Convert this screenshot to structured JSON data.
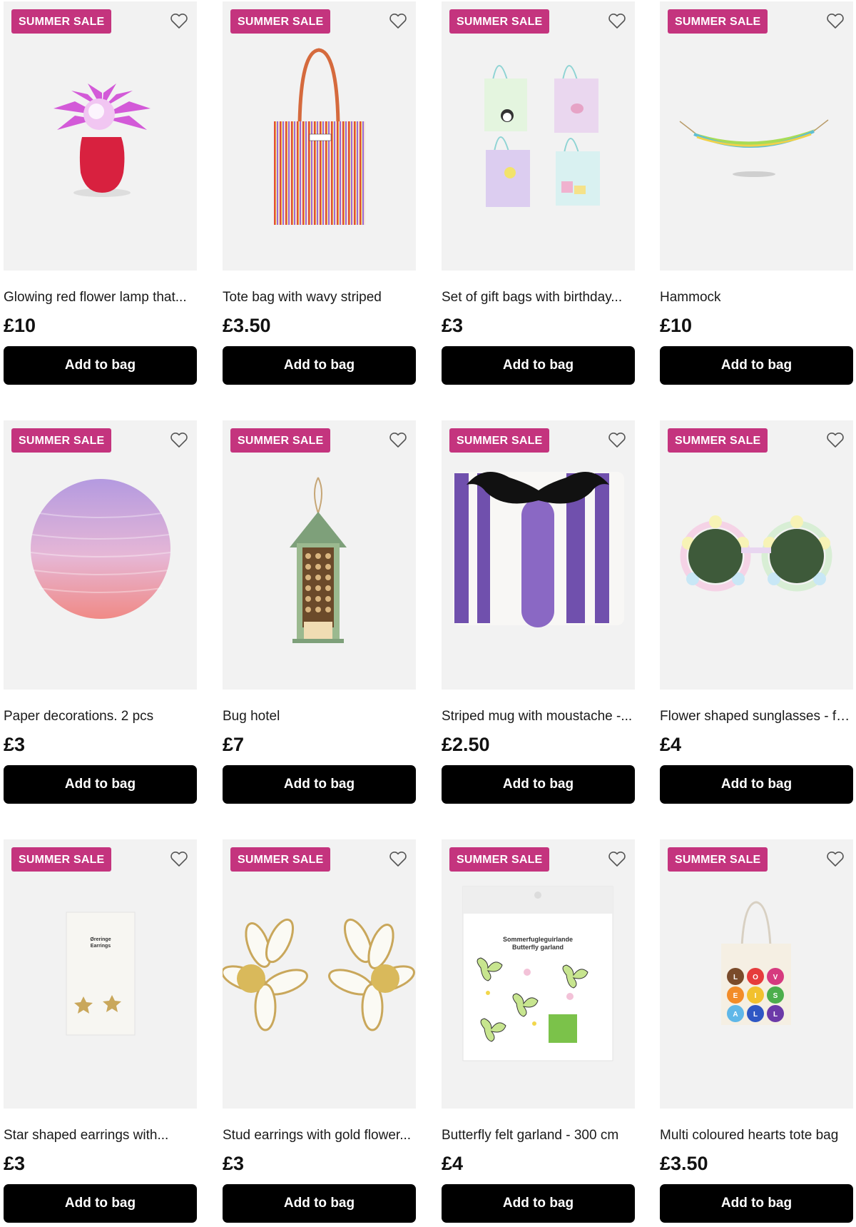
{
  "badge_label": "SUMMER SALE",
  "add_label": "Add to bag",
  "products": [
    {
      "title": "Glowing red flower lamp that...",
      "price": "£10",
      "image": "flower-lamp"
    },
    {
      "title": "Tote bag with wavy striped",
      "price": "£3.50",
      "image": "striped-tote"
    },
    {
      "title": "Set of gift bags with birthday...",
      "price": "£3",
      "image": "gift-bags"
    },
    {
      "title": "Hammock",
      "price": "£10",
      "image": "hammock"
    },
    {
      "title": "Paper decorations. 2 pcs",
      "price": "£3",
      "image": "paper-lantern"
    },
    {
      "title": "Bug hotel",
      "price": "£7",
      "image": "bug-hotel"
    },
    {
      "title": "Striped mug with moustache -...",
      "price": "£2.50",
      "image": "moustache-mug"
    },
    {
      "title": "Flower shaped sunglasses - fo...",
      "price": "£4",
      "image": "flower-sunglasses"
    },
    {
      "title": "Star shaped earrings with...",
      "price": "£3",
      "image": "star-earrings",
      "package_text": [
        "Øreringe",
        "Earrings"
      ]
    },
    {
      "title": "Stud earrings with gold flower...",
      "price": "£3",
      "image": "daisy-earrings"
    },
    {
      "title": "Butterfly felt garland - 300 cm",
      "price": "£4",
      "image": "butterfly-garland",
      "package_text": [
        "Sommerfugleguirlande",
        "Butterfly garland"
      ]
    },
    {
      "title": "Multi coloured hearts tote bag",
      "price": "£3.50",
      "image": "hearts-tote",
      "heart_letters": [
        "L",
        "O",
        "V",
        "E",
        "I",
        "S",
        "A",
        "L",
        "L"
      ]
    }
  ],
  "colors": {
    "badge": "#c4347e",
    "button": "#000000",
    "image_bg": "#f2f2f2"
  }
}
